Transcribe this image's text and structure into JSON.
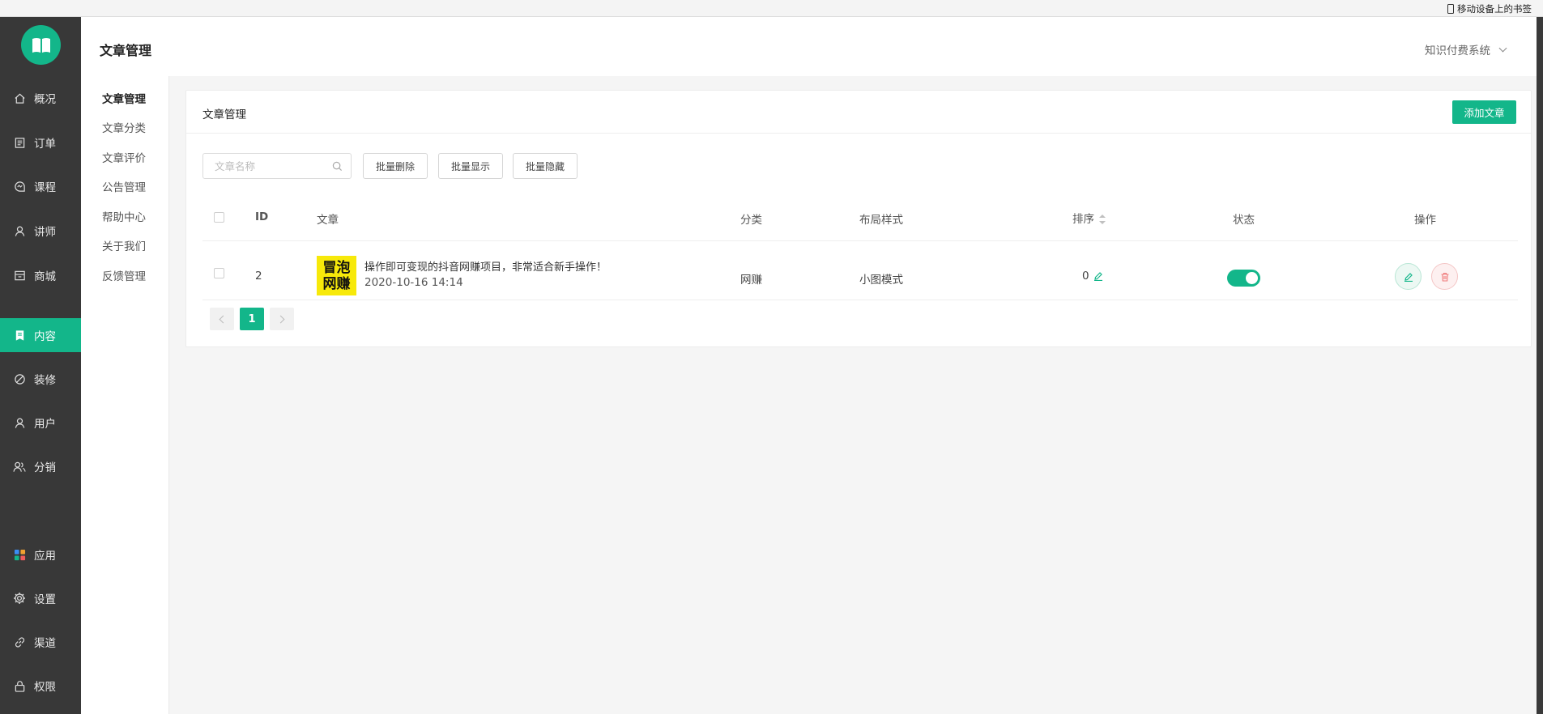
{
  "browser": {
    "bookmark_label": "移动设备上的书签"
  },
  "sidebar": {
    "items": [
      {
        "label": "概况",
        "icon": "home-icon"
      },
      {
        "label": "订单",
        "icon": "order-icon"
      },
      {
        "label": "课程",
        "icon": "course-icon"
      },
      {
        "label": "讲师",
        "icon": "teacher-icon"
      },
      {
        "label": "商城",
        "icon": "shop-icon"
      },
      {
        "label": "内容",
        "icon": "content-icon",
        "active": true
      },
      {
        "label": "装修",
        "icon": "decorate-icon"
      },
      {
        "label": "用户",
        "icon": "user-icon"
      },
      {
        "label": "分销",
        "icon": "distribution-icon"
      },
      {
        "label": "应用",
        "icon": "apps-icon"
      },
      {
        "label": "设置",
        "icon": "gear-icon"
      },
      {
        "label": "渠道",
        "icon": "link-icon"
      },
      {
        "label": "权限",
        "icon": "lock-icon"
      }
    ]
  },
  "subnav": {
    "items": [
      {
        "label": "文章管理",
        "active": true
      },
      {
        "label": "文章分类"
      },
      {
        "label": "文章评价"
      },
      {
        "label": "公告管理"
      },
      {
        "label": "帮助中心"
      },
      {
        "label": "关于我们"
      },
      {
        "label": "反馈管理"
      }
    ]
  },
  "header": {
    "title": "文章管理",
    "system_switch": "知识付费系统"
  },
  "card": {
    "title": "文章管理",
    "add_button": "添加文章",
    "search_placeholder": "文章名称",
    "bulk_delete": "批量删除",
    "bulk_show": "批量显示",
    "bulk_hide": "批量隐藏"
  },
  "table": {
    "columns": {
      "id": "ID",
      "article": "文章",
      "category": "分类",
      "layout": "布局样式",
      "sort": "排序",
      "status": "状态",
      "actions": "操作"
    },
    "rows": [
      {
        "id": "2",
        "thumb_line1": "冒泡",
        "thumb_line2": "网赚",
        "title": "操作即可变现的抖音网赚项目，非常适合新手操作！",
        "date": "2020-10-16 14:14",
        "category": "网赚",
        "layout": "小图模式",
        "sort": "0",
        "status_on": true
      }
    ]
  },
  "pagination": {
    "current": "1"
  },
  "colors": {
    "primary": "#13b68a",
    "sidebar_bg": "#383838",
    "danger": "#f08a8a"
  }
}
